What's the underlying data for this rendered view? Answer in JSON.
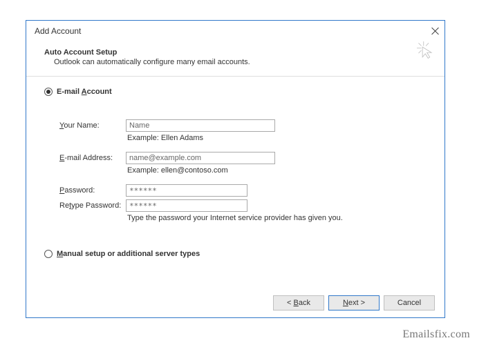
{
  "window": {
    "title": "Add Account"
  },
  "header": {
    "title": "Auto Account Setup",
    "subtitle": "Outlook can automatically configure many email accounts."
  },
  "radio": {
    "email_account": "E-mail Account",
    "manual": "Manual setup or additional server types"
  },
  "form": {
    "name_label": "Your Name:",
    "name_value": "Name",
    "name_hint": "Example: Ellen Adams",
    "email_label": "E-mail Address:",
    "email_value": "name@example.com",
    "email_hint": "Example: ellen@contoso.com",
    "password_label": "Password:",
    "password_value": "******",
    "retype_label": "Retype Password:",
    "retype_value": "******",
    "password_hint": "Type the password your Internet service provider has given you."
  },
  "buttons": {
    "back": "< Back",
    "next": "Next >",
    "cancel": "Cancel"
  },
  "watermark": "Emailsfix.com"
}
